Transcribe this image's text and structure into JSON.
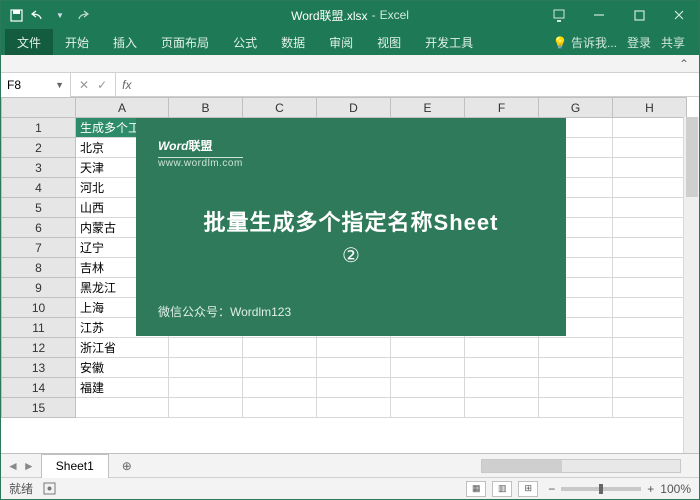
{
  "title": {
    "filename": "Word联盟.xlsx",
    "app": "Excel"
  },
  "qat": {
    "save": "save",
    "undo": "undo",
    "redo": "redo"
  },
  "tabs": [
    "文件",
    "开始",
    "插入",
    "页面布局",
    "公式",
    "数据",
    "审阅",
    "视图",
    "开发工具"
  ],
  "tellme": "告诉我...",
  "signin": "登录",
  "share": "共享",
  "namebox": "F8",
  "columns": [
    "A",
    "B",
    "C",
    "D",
    "E",
    "F",
    "G",
    "H"
  ],
  "rows": [
    {
      "n": 1,
      "a": "生成多个工作表"
    },
    {
      "n": 2,
      "a": "北京"
    },
    {
      "n": 3,
      "a": "天津"
    },
    {
      "n": 4,
      "a": "河北"
    },
    {
      "n": 5,
      "a": "山西"
    },
    {
      "n": 6,
      "a": "内蒙古"
    },
    {
      "n": 7,
      "a": "辽宁"
    },
    {
      "n": 8,
      "a": "吉林"
    },
    {
      "n": 9,
      "a": "黑龙江"
    },
    {
      "n": 10,
      "a": "上海"
    },
    {
      "n": 11,
      "a": "江苏"
    },
    {
      "n": 12,
      "a": "浙江省"
    },
    {
      "n": 13,
      "a": "安徽"
    },
    {
      "n": 14,
      "a": "福建"
    },
    {
      "n": 15,
      "a": ""
    }
  ],
  "overlay": {
    "logo_w": "Word",
    "logo_lm": "联盟",
    "url": "www.wordlm.com",
    "title": "批量生成多个指定名称Sheet",
    "num": "②",
    "foot": "微信公众号：Wordlm123"
  },
  "sheet": "Sheet1",
  "status": {
    "ready": "就绪",
    "zoom": "100%"
  }
}
